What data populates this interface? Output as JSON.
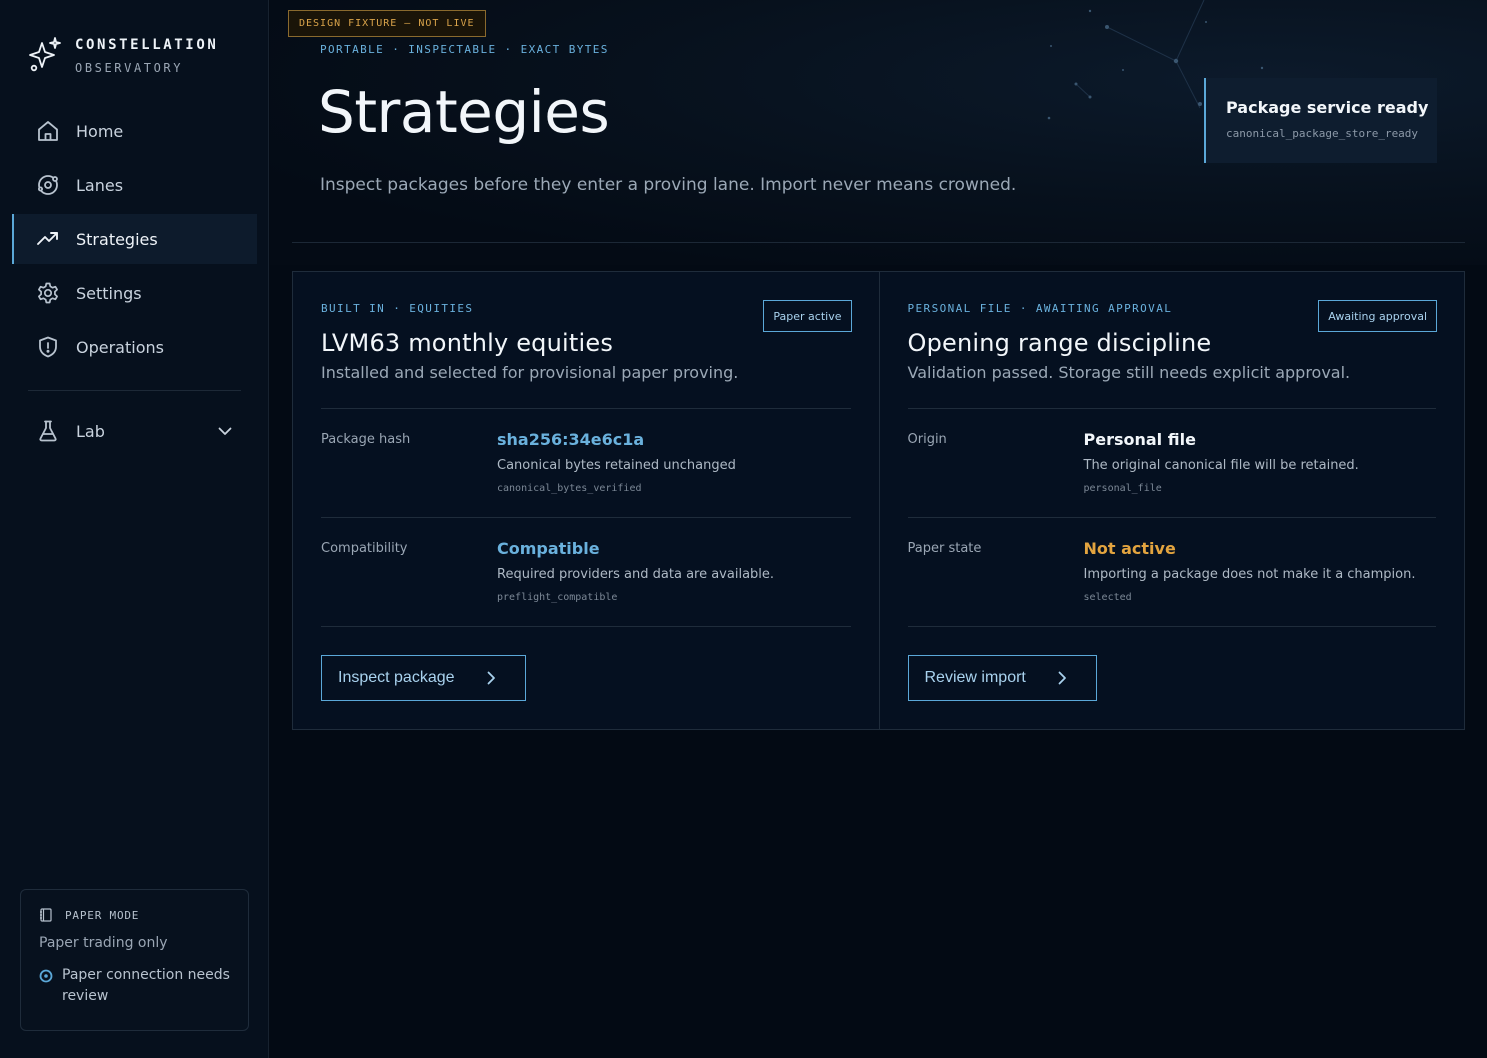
{
  "brand": {
    "name": "CONSTELLATION",
    "sub": "OBSERVATORY"
  },
  "nav": {
    "items": [
      {
        "label": "Home",
        "icon": "home-icon"
      },
      {
        "label": "Lanes",
        "icon": "orbit-icon"
      },
      {
        "label": "Strategies",
        "icon": "trend-up-icon",
        "active": true
      },
      {
        "label": "Settings",
        "icon": "gear-icon"
      },
      {
        "label": "Operations",
        "icon": "shield-icon"
      }
    ],
    "lab": {
      "label": "Lab",
      "icon": "flask-icon"
    }
  },
  "paper_mode": {
    "title": "PAPER MODE",
    "subtitle": "Paper trading only",
    "status": "Paper connection needs review"
  },
  "fixture_banner": "DESIGN FIXTURE — NOT LIVE",
  "header": {
    "eyebrow": "PORTABLE · INSPECTABLE · EXACT BYTES",
    "title": "Strategies",
    "description": "Inspect packages before they enter a proving lane. Import never means crowned."
  },
  "service_status": {
    "title": "Package service ready",
    "code": "canonical_package_store_ready"
  },
  "cards": [
    {
      "eyebrow": "BUILT IN · EQUITIES",
      "badge": "Paper active",
      "title": "LVM63 monthly equities",
      "description": "Installed and selected for provisional paper proving.",
      "rows": [
        {
          "label": "Package hash",
          "value": "sha256:34e6c1a",
          "sub": "Canonical bytes retained unchanged",
          "code": "canonical_bytes_verified"
        },
        {
          "label": "Compatibility",
          "value": "Compatible",
          "sub": "Required providers and data are available.",
          "code": "preflight_compatible"
        }
      ],
      "button": "Inspect package"
    },
    {
      "eyebrow": "PERSONAL FILE · AWAITING APPROVAL",
      "badge": "Awaiting approval",
      "title": "Opening range discipline",
      "description": "Validation passed. Storage still needs explicit approval.",
      "rows": [
        {
          "label": "Origin",
          "value": "Personal file",
          "sub": "The original canonical file will be retained.",
          "code": "personal_file"
        },
        {
          "label": "Paper state",
          "value": "Not active",
          "sub": "Importing a package does not make it a champion.",
          "code": "selected"
        }
      ],
      "button": "Review import"
    }
  ],
  "colors": {
    "accent": "#5ba8d8",
    "warning": "#e3a43f",
    "background": "#030a14"
  }
}
